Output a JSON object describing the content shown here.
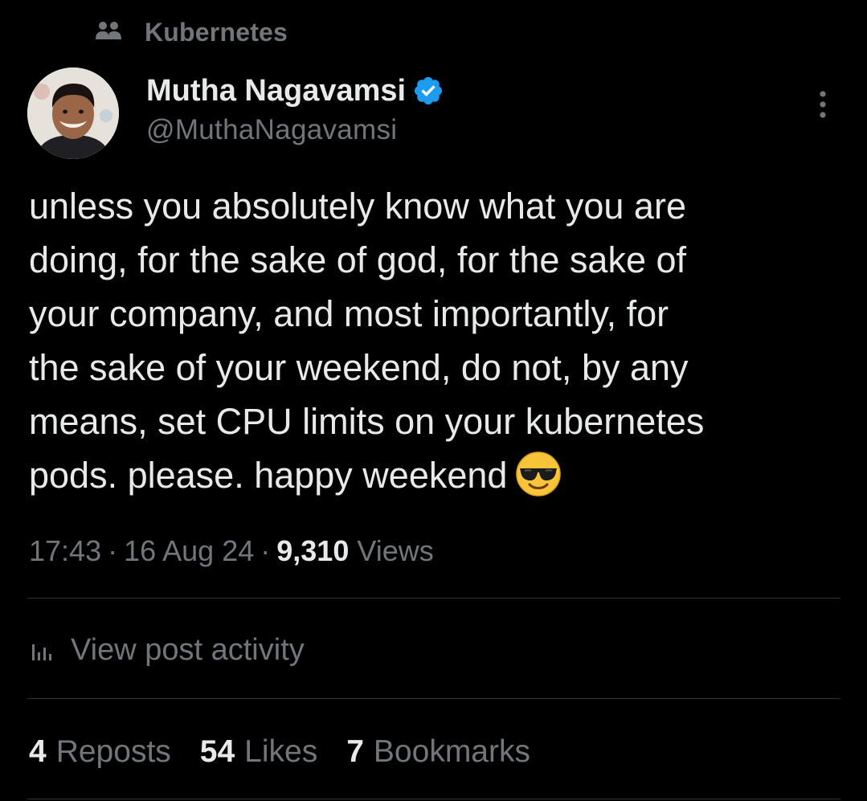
{
  "community": {
    "name": "Kubernetes",
    "icon": "community-people-icon"
  },
  "author": {
    "name": "Mutha Nagavamsi",
    "handle": "@MuthaNagavamsi",
    "verified": true,
    "verified_color": "#1d9bf0"
  },
  "tweet": {
    "lines": [
      "unless you absolutely know what you are",
      "doing, for the sake of god, for the sake of",
      "your company, and most importantly, for",
      "the sake of your weekend, do not, by any",
      "means, set CPU limits on your kubernetes",
      "pods. please. happy weekend"
    ],
    "emoji": "smiling-face-with-sunglasses"
  },
  "meta": {
    "time": "17:43",
    "separator": "·",
    "date": "16 Aug 24",
    "views_count": "9,310",
    "views_label": "Views"
  },
  "activity": {
    "label": "View post activity",
    "icon": "bar-chart-icon"
  },
  "stats": {
    "reposts_count": "4",
    "reposts_label": "Reposts",
    "likes_count": "54",
    "likes_label": "Likes",
    "bookmarks_count": "7",
    "bookmarks_label": "Bookmarks"
  },
  "colors": {
    "background": "#000000",
    "primary_text": "#e7e9ea",
    "secondary_text": "#71767b",
    "divider": "#2f3336",
    "accent": "#1d9bf0"
  }
}
